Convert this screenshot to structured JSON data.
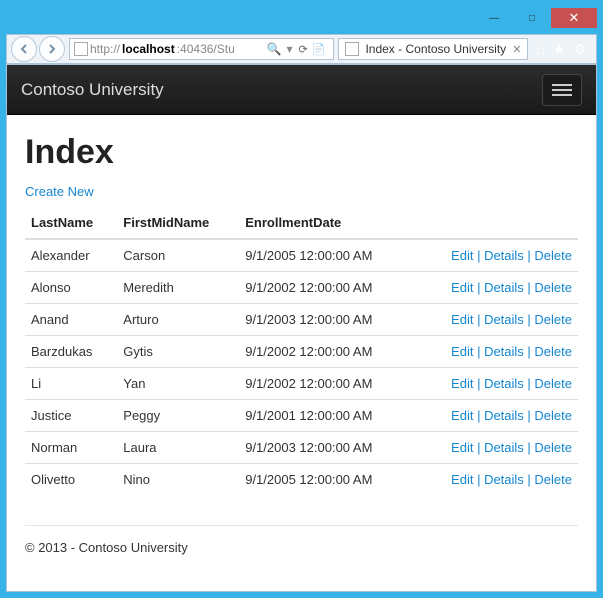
{
  "window": {
    "minimize": "—",
    "maximize": "□",
    "close": "✕"
  },
  "browser": {
    "url_prefix": "http://",
    "url_host": "localhost",
    "url_rest": ":40436/Stu",
    "search_glyph": "🔍",
    "refresh_glyph": "⟳",
    "stop_glyph": "📄",
    "tab_title": "Index - Contoso University",
    "tab_close": "✕",
    "home_glyph": "⌂",
    "fav_glyph": "★",
    "gear_glyph": "⚙"
  },
  "navbar": {
    "brand": "Contoso University"
  },
  "page": {
    "title": "Index",
    "create_label": "Create New"
  },
  "table": {
    "headers": {
      "lastname": "LastName",
      "firstname": "FirstMidName",
      "enrollment": "EnrollmentDate"
    },
    "actions": {
      "edit": "Edit",
      "details": "Details",
      "delete": "Delete",
      "sep": " | "
    },
    "rows": [
      {
        "lastname": "Alexander",
        "firstname": "Carson",
        "enrollment": "9/1/2005 12:00:00 AM"
      },
      {
        "lastname": "Alonso",
        "firstname": "Meredith",
        "enrollment": "9/1/2002 12:00:00 AM"
      },
      {
        "lastname": "Anand",
        "firstname": "Arturo",
        "enrollment": "9/1/2003 12:00:00 AM"
      },
      {
        "lastname": "Barzdukas",
        "firstname": "Gytis",
        "enrollment": "9/1/2002 12:00:00 AM"
      },
      {
        "lastname": "Li",
        "firstname": "Yan",
        "enrollment": "9/1/2002 12:00:00 AM"
      },
      {
        "lastname": "Justice",
        "firstname": "Peggy",
        "enrollment": "9/1/2001 12:00:00 AM"
      },
      {
        "lastname": "Norman",
        "firstname": "Laura",
        "enrollment": "9/1/2003 12:00:00 AM"
      },
      {
        "lastname": "Olivetto",
        "firstname": "Nino",
        "enrollment": "9/1/2005 12:00:00 AM"
      }
    ]
  },
  "footer": {
    "text": "© 2013 - Contoso University"
  }
}
